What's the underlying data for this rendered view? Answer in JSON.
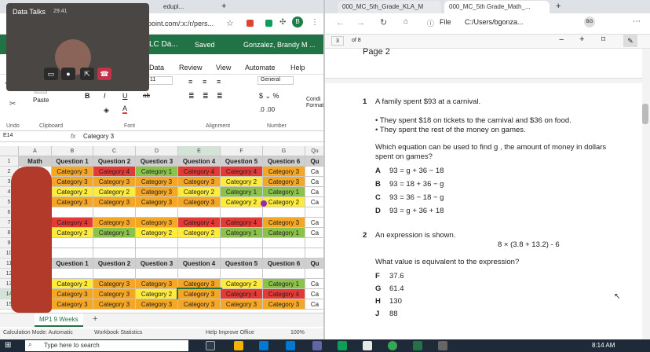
{
  "left_browser": {
    "tab1": "Gonzalez, Brandy M...",
    "tab2": "edupl...",
    "url": "point.com/:x:/r/pers..."
  },
  "video": {
    "name": "Data Talks",
    "time": "29:41"
  },
  "excel": {
    "doc_title": "LC Da...",
    "saved": "Saved",
    "user": "Gonzalez, Brandy M ...",
    "menu": [
      "Data",
      "Review",
      "View",
      "Automate",
      "Help"
    ],
    "font_size": "11",
    "number_format": "General",
    "ribbon_labels": {
      "undo": "Undo",
      "clipboard": "Clipboard",
      "font": "Font",
      "alignment": "Alignment",
      "number": "Number",
      "paste": "Paste",
      "cond": "Condi Format"
    },
    "name_box": "E14",
    "fx": "fx",
    "formula": "Category 3",
    "col_letters": [
      "A",
      "B",
      "C",
      "D",
      "E",
      "F",
      "G",
      "Qu"
    ],
    "header1": [
      "Math",
      "Question 1",
      "Question 2",
      "Question 3",
      "Question 4",
      "Question 5",
      "Question 6",
      "Qu"
    ],
    "header2": [
      "g",
      "Question 1",
      "Question 2",
      "Question 3",
      "Question 4",
      "Question 5",
      "Question 6",
      "Qu"
    ],
    "rows": [
      [
        "Category 3",
        "Category 4",
        "Category 1",
        "Category 4",
        "Category 4",
        "Category 3",
        "Ca"
      ],
      [
        "Category 3",
        "Category 3",
        "Category 3",
        "Category 3",
        "Category 2",
        "Category 3",
        "Ca"
      ],
      [
        "Category 2",
        "Category 2",
        "Category 3",
        "Category 2",
        "Category 1",
        "Category 1",
        "Ca"
      ],
      [
        "Category 3",
        "Category 3",
        "Category 3",
        "Category 3",
        "Category 2",
        "Category 2",
        "Ca"
      ],
      [
        "",
        "",
        "",
        "",
        "",
        "",
        ""
      ],
      [
        "Category 4",
        "Category 3",
        "Category 3",
        "Category 4",
        "Category 4",
        "Category 3",
        "Ca"
      ],
      [
        "Category 2",
        "Category 1",
        "Category 2",
        "Category 2",
        "Category 1",
        "Category 1",
        "Ca"
      ],
      [
        "",
        "",
        "",
        "",
        "",
        "",
        ""
      ],
      [
        "",
        "",
        "",
        "",
        "",
        "",
        ""
      ],
      [
        "",
        "",
        "",
        "",
        "",
        "",
        ""
      ],
      [
        "",
        "",
        "",
        "",
        "",
        "",
        ""
      ],
      [
        "Category 2",
        "Category 3",
        "Category 3",
        "Category 3",
        "Category 2",
        "Category 1",
        "Ca"
      ],
      [
        "Category 3",
        "Category 3",
        "Category 2",
        "Category 3",
        "Category 4",
        "Category 4",
        "Ca"
      ],
      [
        "Category 3",
        "Category 3",
        "Category 3",
        "Category 3",
        "Category 3",
        "Category 3",
        "Ca"
      ]
    ],
    "sheet_tab": "MP1 9 Weeks",
    "status": {
      "calc": "Calculation Mode: Automatic",
      "stats": "Workbook Statistics",
      "help": "Help Improve Office",
      "zoom": "100%"
    }
  },
  "colors": {
    "cat1": "#8bc34a",
    "cat2": "#ffeb3b",
    "cat3": "#f5a623",
    "cat4": "#e53935",
    "excel_green": "#217346"
  },
  "pdf": {
    "tab1": "000_MC_5th_Grade_KLA_M",
    "tab2": "000_MC_5th Grade_Math_...",
    "url_label": "File",
    "url": "C:/Users/bgonza...",
    "profile": "BG",
    "page_num": "3",
    "page_of": "of 8",
    "page_label": "Page 2",
    "q1": {
      "num": "1",
      "stem": "A family spent $93 at a carnival.",
      "b1": "They spent $18 on tickets to the carnival and $36 on food.",
      "b2": "They spent the rest of the money on games.",
      "ask1": "Which equation can be used to find g , the amount of money in dollars",
      "ask2": "spent on games?",
      "opts": [
        [
          "A",
          "93 = g + 36 − 18"
        ],
        [
          "B",
          "93 = 18 + 36 − g"
        ],
        [
          "C",
          "93 = 36 − 18 − g"
        ],
        [
          "D",
          "93 = g + 36 + 18"
        ]
      ]
    },
    "q2": {
      "num": "2",
      "stem": "An expression is shown.",
      "expr": "8 × (3.8 + 13.2) - 6",
      "ask": "What value is equivalent to the expression?",
      "opts": [
        [
          "F",
          "37.6"
        ],
        [
          "G",
          "61.4"
        ],
        [
          "H",
          "130"
        ],
        [
          "J",
          "88"
        ]
      ]
    }
  },
  "taskbar": {
    "search": "Type here to search",
    "time": "8:14 AM"
  }
}
